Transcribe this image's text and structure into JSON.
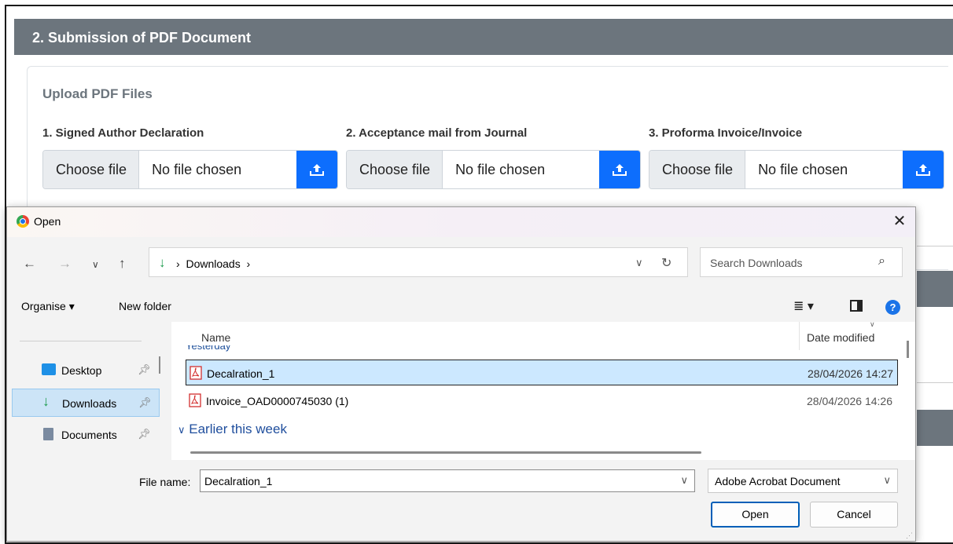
{
  "page": {
    "section_title": "2. Submission of PDF Document",
    "upload_title": "Upload PDF Files",
    "fields": [
      {
        "label": "1. Signed Author Declaration",
        "choose": "Choose file",
        "status": "No file chosen"
      },
      {
        "label": "2. Acceptance mail from Journal",
        "choose": "Choose file",
        "status": "No file chosen"
      },
      {
        "label": "3. Proforma Invoice/Invoice",
        "choose": "Choose file",
        "status": "No file chosen"
      }
    ]
  },
  "dialog": {
    "title": "Open",
    "nav": {
      "breadcrumb": "Downloads",
      "breadcrumb_sep": "›",
      "search_placeholder": "Search Downloads"
    },
    "toolbar": {
      "organise": "Organise ▾",
      "new_folder": "New folder"
    },
    "sidebar": [
      {
        "label": "Desktop",
        "icon": "desktop-icon",
        "selected": false
      },
      {
        "label": "Downloads",
        "icon": "download-icon",
        "selected": true
      },
      {
        "label": "Documents",
        "icon": "documents-icon",
        "selected": false
      }
    ],
    "columns": {
      "name": "Name",
      "date": "Date modified"
    },
    "partial_group": "Yesterday",
    "files": [
      {
        "name": "Decalration_1",
        "date": "28/04/2026 14:27",
        "selected": true,
        "icon": "pdf-icon"
      },
      {
        "name": "Invoice_OAD0000745030 (1)",
        "date": "28/04/2026 14:26",
        "selected": false,
        "icon": "pdf-icon"
      }
    ],
    "group_earlier": "Earlier this week",
    "footer": {
      "file_name_label": "File name:",
      "file_name_value": "Decalration_1",
      "file_type": "Adobe Acrobat Document",
      "open": "Open",
      "cancel": "Cancel"
    }
  },
  "colors": {
    "upload_button": "#0d6efd",
    "header": "#6c757d",
    "selection": "#cce8ff"
  }
}
